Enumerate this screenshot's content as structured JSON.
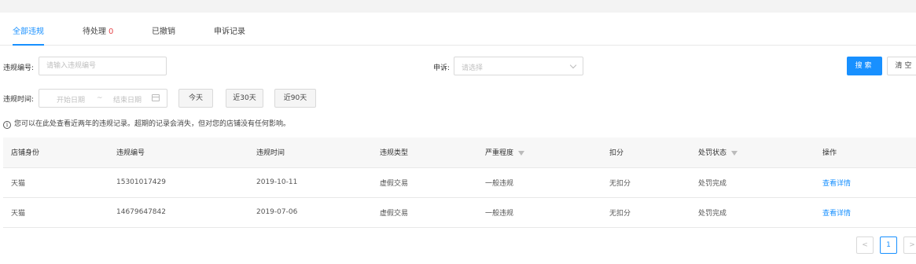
{
  "tabs": [
    {
      "label": "全部违规"
    },
    {
      "label": "待处理",
      "count": "0"
    },
    {
      "label": "已撤销"
    },
    {
      "label": "申诉记录"
    }
  ],
  "filters": {
    "violation_no_label": "违规编号:",
    "violation_no_placeholder": "请输入违规编号",
    "appeal_label": "申诉:",
    "appeal_placeholder": "请选择",
    "time_label": "违规时间:",
    "start_placeholder": "开始日期",
    "range_sep": "~",
    "end_placeholder": "结束日期",
    "today": "今天",
    "last30": "近30天",
    "last90": "近90天",
    "search": "搜索",
    "clear": "清空"
  },
  "notice": "您可以在此处查看近两年的违规记录。超期的记录会消失，但对您的店铺没有任何影响。",
  "table": {
    "headers": [
      "店铺身份",
      "违规编号",
      "违规时间",
      "违规类型",
      "严重程度",
      "扣分",
      "处罚状态",
      "操作"
    ],
    "rows": [
      [
        "天猫",
        "15301017429",
        "2019-10-11",
        "虚假交易",
        "一般违规",
        "无扣分",
        "处罚完成",
        "查看详情"
      ],
      [
        "天猫",
        "14679647842",
        "2019-07-06",
        "虚假交易",
        "一般违规",
        "无扣分",
        "处罚完成",
        "查看详情"
      ]
    ]
  },
  "pagination": {
    "prev": "<",
    "current": "1",
    "next": ">"
  }
}
